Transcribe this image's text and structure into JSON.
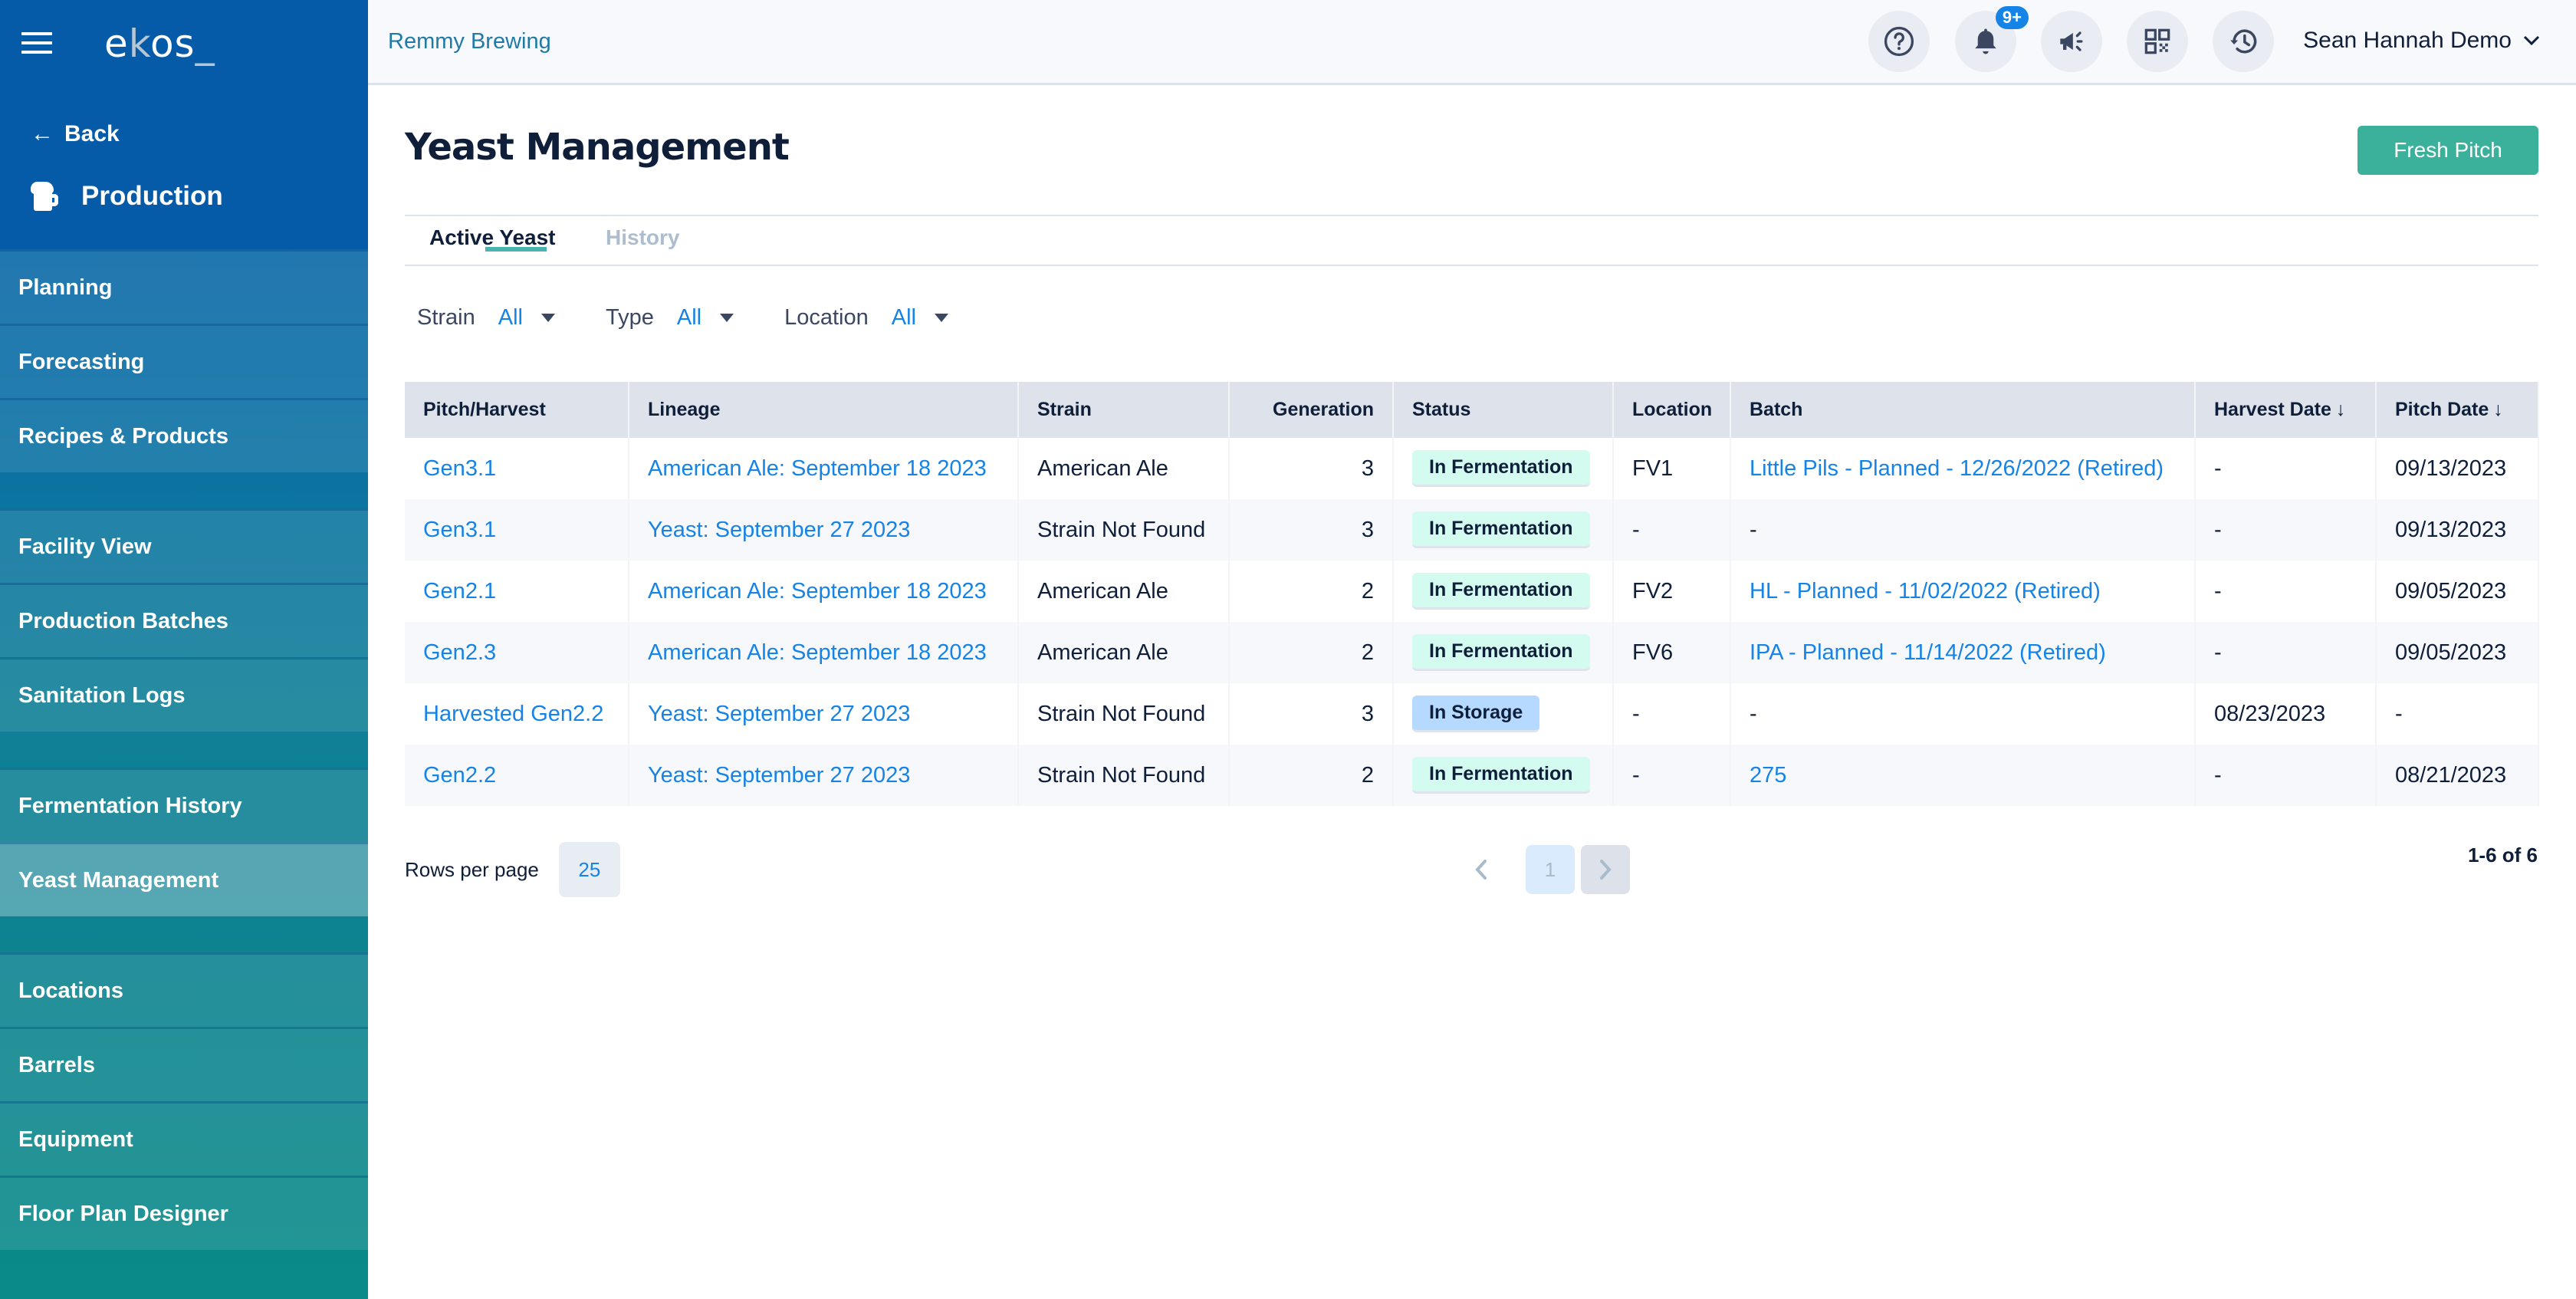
{
  "sidebar": {
    "logo": {
      "e": "e",
      "k": "k",
      "os": "os",
      "underscore": "_"
    },
    "back_label": "Back",
    "back_icon": "arrow-left-icon",
    "section_title": "Production",
    "section_icon": "beer-mug-icon",
    "groups": [
      [
        {
          "label": "Planning"
        },
        {
          "label": "Forecasting"
        },
        {
          "label": "Recipes & Products"
        }
      ],
      [
        {
          "label": "Facility View"
        },
        {
          "label": "Production Batches"
        },
        {
          "label": "Sanitation Logs"
        }
      ],
      [
        {
          "label": "Fermentation History"
        },
        {
          "label": "Yeast Management",
          "active": true
        }
      ],
      [
        {
          "label": "Locations"
        },
        {
          "label": "Barrels"
        },
        {
          "label": "Equipment"
        },
        {
          "label": "Floor Plan Designer"
        }
      ]
    ]
  },
  "header": {
    "org_name": "Remmy Brewing",
    "icons": [
      "help-icon",
      "bell-icon",
      "megaphone-icon",
      "qr-code-icon",
      "history-icon"
    ],
    "notification_badge": "9+",
    "user_name": "Sean Hannah Demo"
  },
  "page": {
    "title": "Yeast Management",
    "primary_button": "Fresh Pitch",
    "tabs": [
      {
        "label": "Active Yeast",
        "active": true
      },
      {
        "label": "History",
        "active": false
      }
    ],
    "filters": [
      {
        "label": "Strain",
        "value": "All"
      },
      {
        "label": "Type",
        "value": "All"
      },
      {
        "label": "Location",
        "value": "All"
      }
    ]
  },
  "table": {
    "columns": [
      "Pitch/Harvest",
      "Lineage",
      "Strain",
      "Generation",
      "Status",
      "Location",
      "Batch",
      "Harvest Date",
      "Pitch Date"
    ],
    "sort_icon": "↓",
    "rows": [
      {
        "pitch": "Gen3.1",
        "lineage": "American Ale: September 18 2023",
        "strain": "American Ale",
        "generation": "3",
        "status": "In Fermentation",
        "location": "FV1",
        "batch": "Little Pils - Planned - 12/26/2022 (Retired)",
        "harvest_date": "-",
        "pitch_date": "09/13/2023"
      },
      {
        "pitch": "Gen3.1",
        "lineage": "Yeast: September 27 2023",
        "strain": "Strain Not Found",
        "generation": "3",
        "status": "In Fermentation",
        "location": "-",
        "batch": "-",
        "harvest_date": "-",
        "pitch_date": "09/13/2023"
      },
      {
        "pitch": "Gen2.1",
        "lineage": "American Ale: September 18 2023",
        "strain": "American Ale",
        "generation": "2",
        "status": "In Fermentation",
        "location": "FV2",
        "batch": "HL - Planned - 11/02/2022 (Retired)",
        "harvest_date": "-",
        "pitch_date": "09/05/2023"
      },
      {
        "pitch": "Gen2.3",
        "lineage": "American Ale: September 18 2023",
        "strain": "American Ale",
        "generation": "2",
        "status": "In Fermentation",
        "location": "FV6",
        "batch": "IPA - Planned - 11/14/2022 (Retired)",
        "harvest_date": "-",
        "pitch_date": "09/05/2023"
      },
      {
        "pitch": "Harvested Gen2.2",
        "lineage": "Yeast: September 27 2023",
        "strain": "Strain Not Found",
        "generation": "3",
        "status": "In Storage",
        "location": "-",
        "batch": "-",
        "harvest_date": "08/23/2023",
        "pitch_date": "-"
      },
      {
        "pitch": "Gen2.2",
        "lineage": "Yeast: September 27 2023",
        "strain": "Strain Not Found",
        "generation": "2",
        "status": "In Fermentation",
        "location": "-",
        "batch": "275",
        "harvest_date": "-",
        "pitch_date": "08/21/2023"
      }
    ]
  },
  "pagination": {
    "rows_per_page_label": "Rows per page",
    "rows_per_page": "25",
    "current_page": "1",
    "range": "1-6 of 6"
  },
  "colors": {
    "accent_link": "#1683e6",
    "primary_button": "#3bb09b",
    "status_fermentation": "#d4fbf0",
    "status_storage": "#b6d9ff"
  }
}
